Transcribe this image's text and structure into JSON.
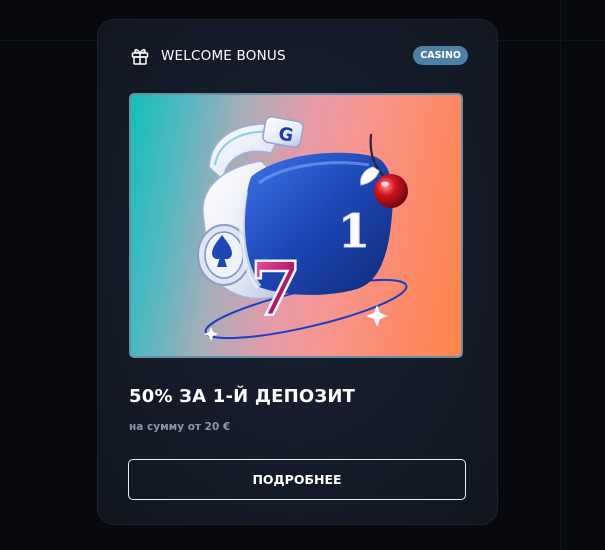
{
  "card": {
    "header_title": "WELCOME BONUS",
    "header_icon": "gift-icon",
    "badge": "CASINO",
    "offer_title": "50% ЗА 1-Й ДЕПОЗИТ",
    "offer_subtitle": "на сумму от 20 €",
    "button_label": "ПОДРОБНЕЕ",
    "banner": {
      "helmet_letter": "G",
      "digit_seven": "7",
      "digit_one": "1",
      "items": [
        "vr-headset",
        "spade-icon",
        "cherry-icon",
        "orbit-ring",
        "sparkle-icon"
      ]
    }
  },
  "colors": {
    "page_bg": "#07090e",
    "card_bg": "#141b29",
    "badge_bg": "#4e7fa5",
    "text_primary": "#ffffff",
    "text_secondary": "#8b96aa",
    "banner_gradient_start": "#13bfb6",
    "banner_gradient_end": "#fd8648"
  }
}
